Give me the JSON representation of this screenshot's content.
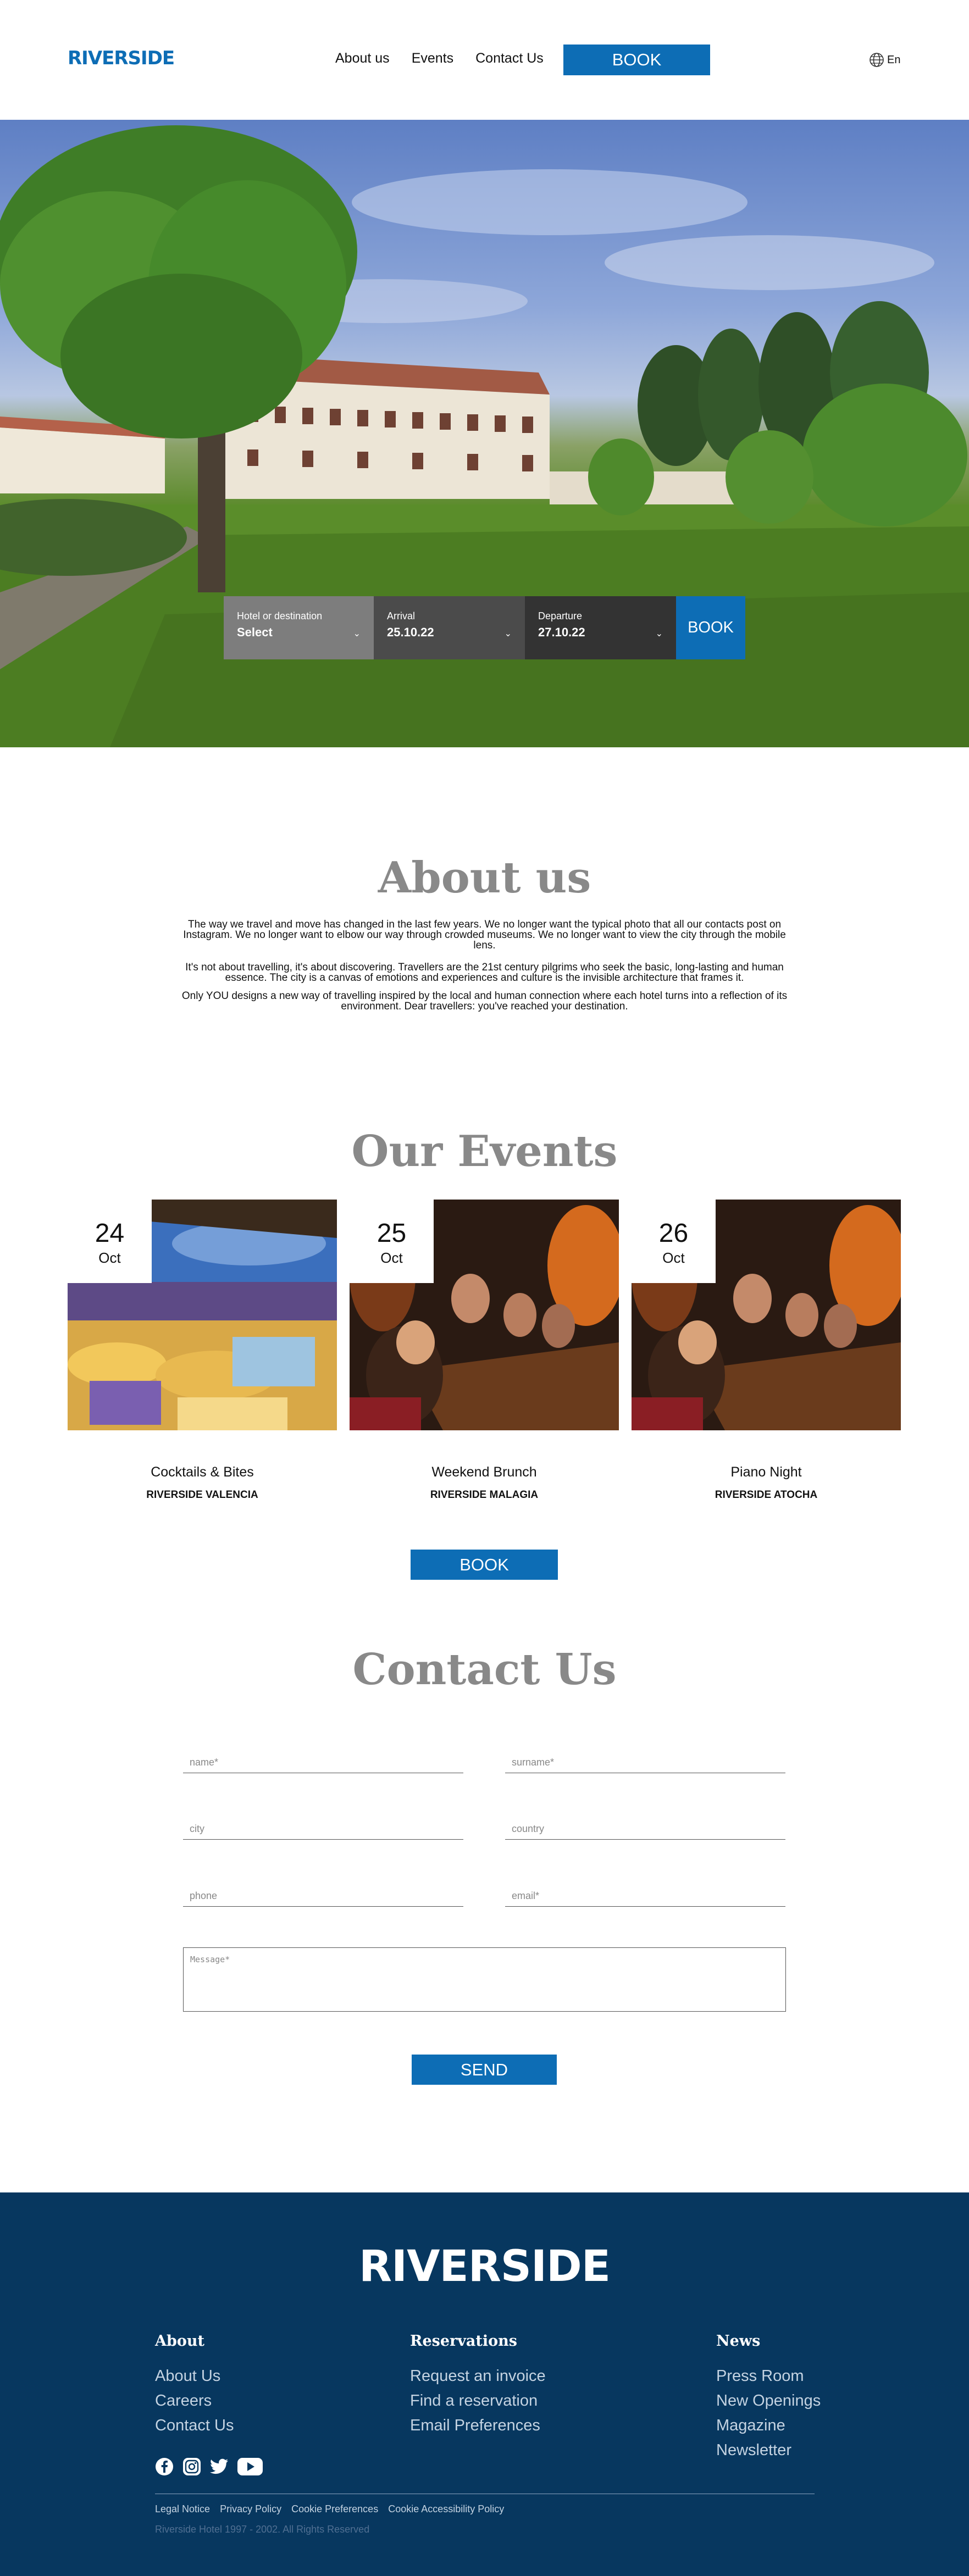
{
  "brand": {
    "logo": "RIVERSIDE",
    "accent": "#0d6db5",
    "footer_bg": "#07375f"
  },
  "header": {
    "nav": [
      "About us",
      "Events",
      "Contact Us"
    ],
    "book_label": "BOOK",
    "lang": "En",
    "lang_icon": "globe-icon"
  },
  "search": {
    "hotel": {
      "label": "Hotel or destination",
      "value": "Select"
    },
    "arrival": {
      "label": "Arrival",
      "value": "25.10.22"
    },
    "departure": {
      "label": "Departure",
      "value": "27.10.22"
    },
    "book_label": "BOOK"
  },
  "about": {
    "title": "About us",
    "paragraphs": [
      "The way we travel and move has changed in the last few years. We no longer want the typical photo that all our contacts post on Instagram. We no longer want to elbow our way through crowded museums. We no longer want to view the city through the mobile lens.",
      "It's not about travelling, it's about discovering. Travellers are the 21st century pilgrims who seek the basic, long-lasting and human essence. The city is a canvas of emotions and experiences and culture is the invisible architecture that frames it.",
      "Only YOU designs a new way of travelling inspired by the local and human connection where each hotel turns into a reflection of its environment. Dear travellers: you've reached your destination."
    ]
  },
  "events": {
    "title": "Our Events",
    "items": [
      {
        "day": "24",
        "month": "Oct",
        "title": "Cocktails & Bites",
        "location": "RIVERSIDE VALENCIA"
      },
      {
        "day": "25",
        "month": "Oct",
        "title": "Weekend Brunch",
        "location": "RIVERSIDE MALAGIA"
      },
      {
        "day": "26",
        "month": "Oct",
        "title": "Piano Night",
        "location": "RIVERSIDE ATOCHA"
      }
    ],
    "book_label": "BOOK"
  },
  "contact": {
    "title": "Contact Us",
    "fields": {
      "name": "name*",
      "surname": "surname*",
      "city": "city",
      "country": "country",
      "phone": "phone",
      "email": "email*",
      "message": "Message*"
    },
    "send_label": "SEND"
  },
  "footer": {
    "logo": "RIVERSIDE",
    "columns": [
      {
        "heading": "About",
        "links": [
          "About Us",
          "Careers",
          "Contact Us"
        ]
      },
      {
        "heading": "Reservations",
        "links": [
          "Request an invoice",
          "Find a reservation",
          "Email Preferences"
        ]
      },
      {
        "heading": "News",
        "links": [
          "Press Room",
          "New Openings",
          "Magazine",
          "Newsletter"
        ]
      }
    ],
    "socials": [
      "facebook-icon",
      "instagram-icon",
      "twitter-icon",
      "youtube-icon"
    ],
    "legal": [
      "Legal Notice",
      "Privacy Policy",
      "Cookie Preferences",
      "Cookie Accessibility Policy"
    ],
    "copyright": "Riverside Hotel 1997 - 2002. All Rights Reserved"
  }
}
